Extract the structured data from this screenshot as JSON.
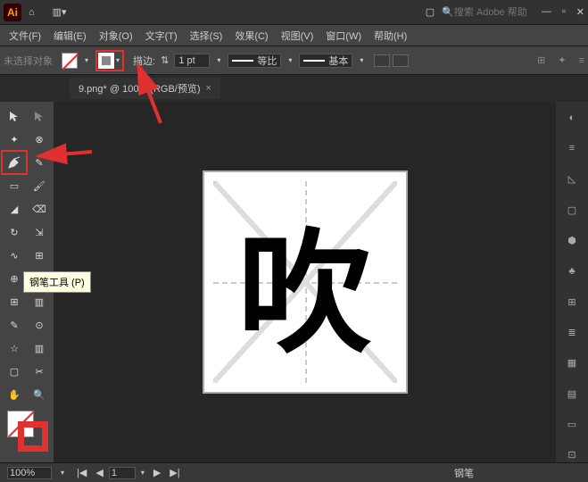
{
  "app": {
    "logo": "Ai"
  },
  "search": {
    "placeholder": "搜索 Adobe 帮助"
  },
  "menu": {
    "file": "文件(F)",
    "edit": "编辑(E)",
    "object": "对象(O)",
    "type": "文字(T)",
    "select": "选择(S)",
    "effect": "效果(C)",
    "view": "视图(V)",
    "window": "窗口(W)",
    "help": "帮助(H)"
  },
  "control": {
    "noselect": "未选择对象",
    "stroke_label": "描边:",
    "stroke_value": "1 pt",
    "dash_label": "等比",
    "profile_label": "基本"
  },
  "tab": {
    "title": "9.png* @ 100% (RGB/预览)",
    "close": "×"
  },
  "tooltip": {
    "pen": "钢笔工具 (P)"
  },
  "tools": {
    "selection": "▲",
    "direct": "▷",
    "magic": "✦",
    "lasso": "⊗",
    "pen": "✒",
    "curvature": "✎",
    "rect": "▭",
    "brush": "🖌",
    "shaper": "◢",
    "eraser": "⌫",
    "rotate": "↻",
    "scale": "⇲",
    "width": "✂",
    "warp": "⊕",
    "mesh": "⊞",
    "gradient": "▦",
    "eyedrop": "✎",
    "blend": "⊙",
    "symbol": "☆",
    "graph": "▥",
    "artboard": "▢",
    "slice": "✂",
    "hand": "✋",
    "zoom": "🔍"
  },
  "canvas": {
    "char": "吹"
  },
  "status": {
    "zoom": "100%",
    "page": "1",
    "tool": "钢笔"
  },
  "right": {
    "icons": [
      "◐",
      "≡",
      "◺",
      "▢",
      "⬢",
      "♣",
      "⊞",
      "≣",
      "▦",
      "▤",
      "▭",
      "⊡"
    ]
  }
}
